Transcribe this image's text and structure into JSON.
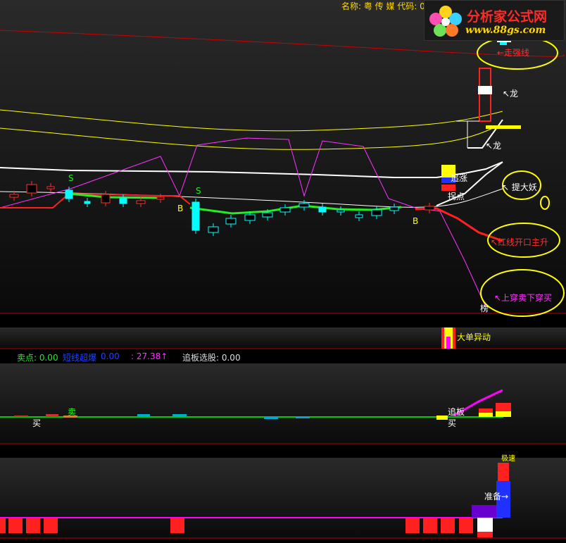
{
  "header": {
    "title": "名称: 粤 传 媒 代码: 00",
    "logo_cn": "分析家公式网",
    "logo_url": "www.88gs.com"
  },
  "annotations": {
    "zouqiang": "←走强线",
    "long1": "↖龙",
    "long2": "↖龙",
    "tidayao": "↖ 提大妖",
    "hongxian": "↖红线开口主升",
    "shangchuan": "↖上穿卖下穿买",
    "zhuizhang": "追涨",
    "guaidian": "拐点",
    "dadan": "大单异动",
    "zhuiban": "追板",
    "zhunbei": "准备→",
    "jisu": "极速",
    "mai_buy": "买",
    "mai_sell": "卖",
    "mai_buy2": "买",
    "s_mark": "S",
    "b_mark": "B",
    "bang": "榜"
  },
  "status": {
    "sell_label": "卖点: 0.00",
    "blue_label": "短线超爆",
    "blue_val": "0.00",
    "mag_label": ": 27.38↑",
    "zhuiban_label": "追板选股: 0.00"
  },
  "colors": {
    "up": "#ff3030",
    "down": "#00ffff",
    "yellow": "#ffff00",
    "magenta": "#ff00ff",
    "green": "#00ff00",
    "white": "#ffffff",
    "panel_bg": "#1c1c1c",
    "divider": "#b00000"
  },
  "chart_data": {
    "type": "candlestick",
    "count": 45,
    "candles": [
      {
        "o": 0,
        "c": 0
      },
      {
        "o": 0,
        "c": 0
      }
    ]
  }
}
